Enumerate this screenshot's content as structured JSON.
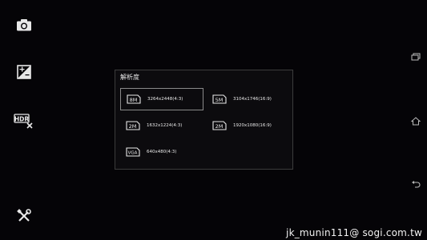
{
  "left_rail": {
    "items": [
      {
        "name": "camera-icon"
      },
      {
        "name": "exposure-icon"
      },
      {
        "name": "hdr-off-icon",
        "text": "HDR"
      },
      {
        "name": "settings-tools-icon"
      }
    ]
  },
  "right_rail": {
    "items": [
      {
        "name": "recent-apps-icon"
      },
      {
        "name": "home-icon"
      },
      {
        "name": "back-icon"
      }
    ]
  },
  "dialog": {
    "title": "解析度",
    "options": [
      {
        "badge": "8M",
        "label": "3264x2448(4:3)",
        "selected": true
      },
      {
        "badge": "5M",
        "label": "3104x1746(16:9)",
        "selected": false
      },
      {
        "badge": "2M",
        "label": "1632x1224(4:3)",
        "selected": false
      },
      {
        "badge": "2M",
        "label": "1920x1080(16:9)",
        "selected": false
      },
      {
        "badge": "VGA",
        "label": "640x480(4:3)",
        "selected": false
      }
    ]
  },
  "watermark": "jk_munin111@ sogi.com.tw",
  "colors": {
    "background": "#050407",
    "dialog_border": "#3c3c3c",
    "selected_border": "#8a8a8a",
    "icon": "#e8e8e8"
  }
}
